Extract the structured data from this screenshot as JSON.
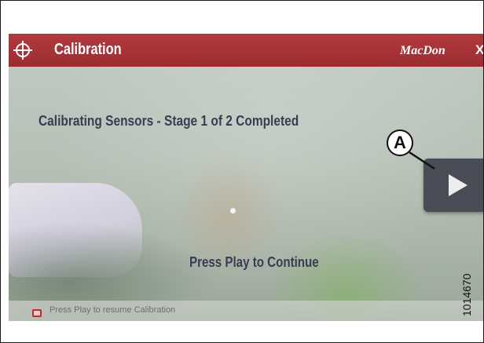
{
  "window": {
    "title": "Calibration",
    "brand": "MacDon",
    "close_glyph": "X"
  },
  "main": {
    "status": "Calibrating Sensors - Stage 1 of 2 Completed",
    "prompt": "Press Play to Continue",
    "play_button_icon": "play-icon"
  },
  "status_bar": {
    "message": "Press Play to resume Calibration",
    "icon": "alert-icon"
  },
  "callout": {
    "label": "A"
  },
  "figure_number": "1014670",
  "colors": {
    "title_bar": "#a33035",
    "text": "#3a3c52",
    "play_button": "#4a4d55"
  }
}
